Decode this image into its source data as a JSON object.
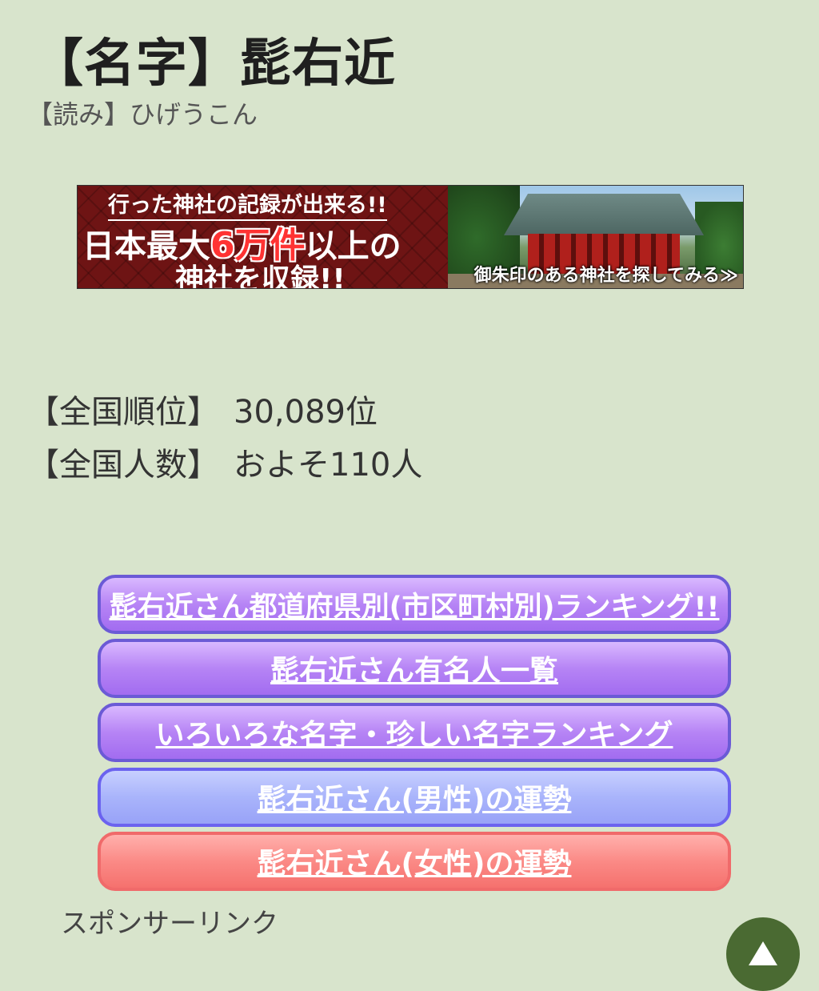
{
  "header": {
    "title": "【名字】髭右近",
    "reading": "【読み】ひげうこん"
  },
  "banner": {
    "line1": "行った神社の記録が出来る!!",
    "line2_prefix": "日本最大",
    "line2_highlight": "6万件",
    "line2_suffix": "以上の",
    "line3": "神社を収録!!",
    "caption": "御朱印のある神社を探してみる≫"
  },
  "stats": {
    "rank_label": "【全国順位】",
    "rank_value": "30,089位",
    "count_label": "【全国人数】",
    "count_value": "およそ110人"
  },
  "buttons": [
    {
      "label": "髭右近さん都道府県別(市区町村別)ランキング!!",
      "color": "#b684f5"
    },
    {
      "label": "髭右近さん有名人一覧",
      "color": "#b684f5"
    },
    {
      "label": "いろいろな名字・珍しい名字ランキング",
      "color": "#b684f5"
    },
    {
      "label": "髭右近さん(男性)の運勢",
      "color": "#a9b4fb"
    },
    {
      "label": "髭右近さん(女性)の運勢",
      "color": "#fb8a86"
    }
  ],
  "sponsor_label": "スポンサーリンク",
  "scroll_top": {
    "icon": "arrow-up-icon",
    "color": "#4a6a32"
  }
}
